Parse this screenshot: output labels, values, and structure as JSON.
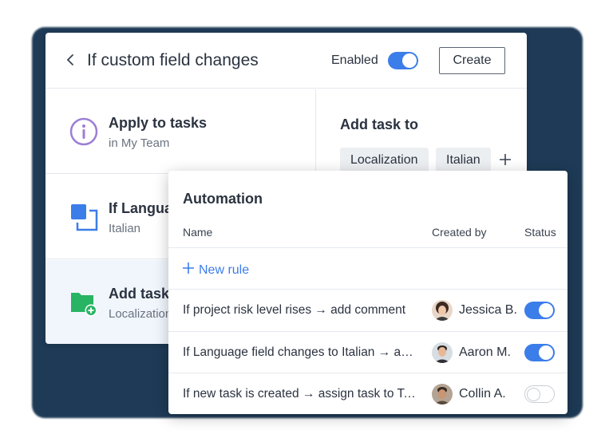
{
  "colors": {
    "accent": "#3b7de9",
    "background_shape": "#1e3a56",
    "info_icon": "#9b7fd4",
    "green_icon": "#28b463"
  },
  "header": {
    "back_icon": "chevron-left-icon",
    "title": "If custom field changes",
    "enabled_label": "Enabled",
    "enabled": true,
    "create_label": "Create"
  },
  "steps": [
    {
      "icon": "info-icon",
      "title": "Apply to tasks",
      "subtitle": "in My Team"
    },
    {
      "icon": "custom-field-icon",
      "title": "If Language field changes",
      "subtitle": "Italian"
    },
    {
      "icon": "folder-add-icon",
      "title": "Add task to",
      "subtitle": "Localization, Italian"
    }
  ],
  "add_task_to": {
    "title": "Add task to",
    "chips": [
      "Localization",
      "Italian"
    ],
    "add_icon": "plus-icon"
  },
  "automation": {
    "title": "Automation",
    "columns": {
      "name": "Name",
      "created_by": "Created by",
      "status": "Status"
    },
    "new_rule_label": "New rule",
    "rules": [
      {
        "name": "If project risk level rises → add comment",
        "created_by": "Jessica B.",
        "enabled": true
      },
      {
        "name": "If Language field changes to Italian → add task",
        "created_by": "Aaron M.",
        "enabled": true
      },
      {
        "name": "If new task is created → assign task to Team",
        "created_by": "Collin A.",
        "enabled": false
      }
    ]
  }
}
